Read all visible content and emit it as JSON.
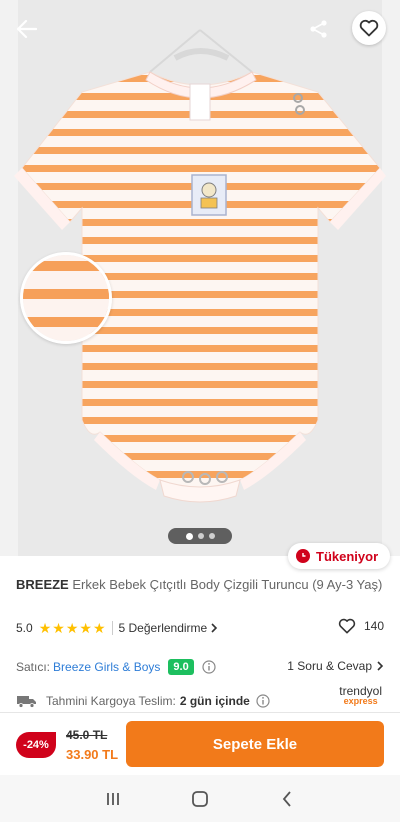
{
  "product": {
    "brand": "BREEZE",
    "name": "Erkek Bebek Çıtçıtlı Body Çizgili Turuncu (9 Ay-3 Yaş)",
    "image_count": 3,
    "active_image": 0
  },
  "stock_badge": "Tükeniyor",
  "rating": {
    "value": "5.0",
    "stars": 5,
    "reviews_label": "5 Değerlendirme"
  },
  "favorites": {
    "count": "140"
  },
  "seller": {
    "label": "Satıcı:",
    "name": "Breeze Girls & Boys",
    "score": "9.0",
    "qa_label": "1 Soru & Cevap"
  },
  "shipping": {
    "label": "Tahmini Kargoya Teslim:",
    "days": "2 gün içinde",
    "logo_line1": "trendyol",
    "logo_line2": "express"
  },
  "price": {
    "discount": "-24%",
    "old": "45.0 TL",
    "new": "33.90 TL"
  },
  "cta": {
    "add_to_cart": "Sepete Ekle"
  },
  "icons": {
    "back": "arrow-left-icon",
    "share": "share-icon",
    "favorite": "heart-icon",
    "clock": "clock-icon",
    "info": "info-icon",
    "truck": "truck-icon"
  },
  "colors": {
    "accent": "#f27a1a",
    "sale_red": "#d0021b",
    "seller_blue": "#2e7dd7",
    "score_green": "#1dbf5f",
    "star": "#ffc000"
  }
}
